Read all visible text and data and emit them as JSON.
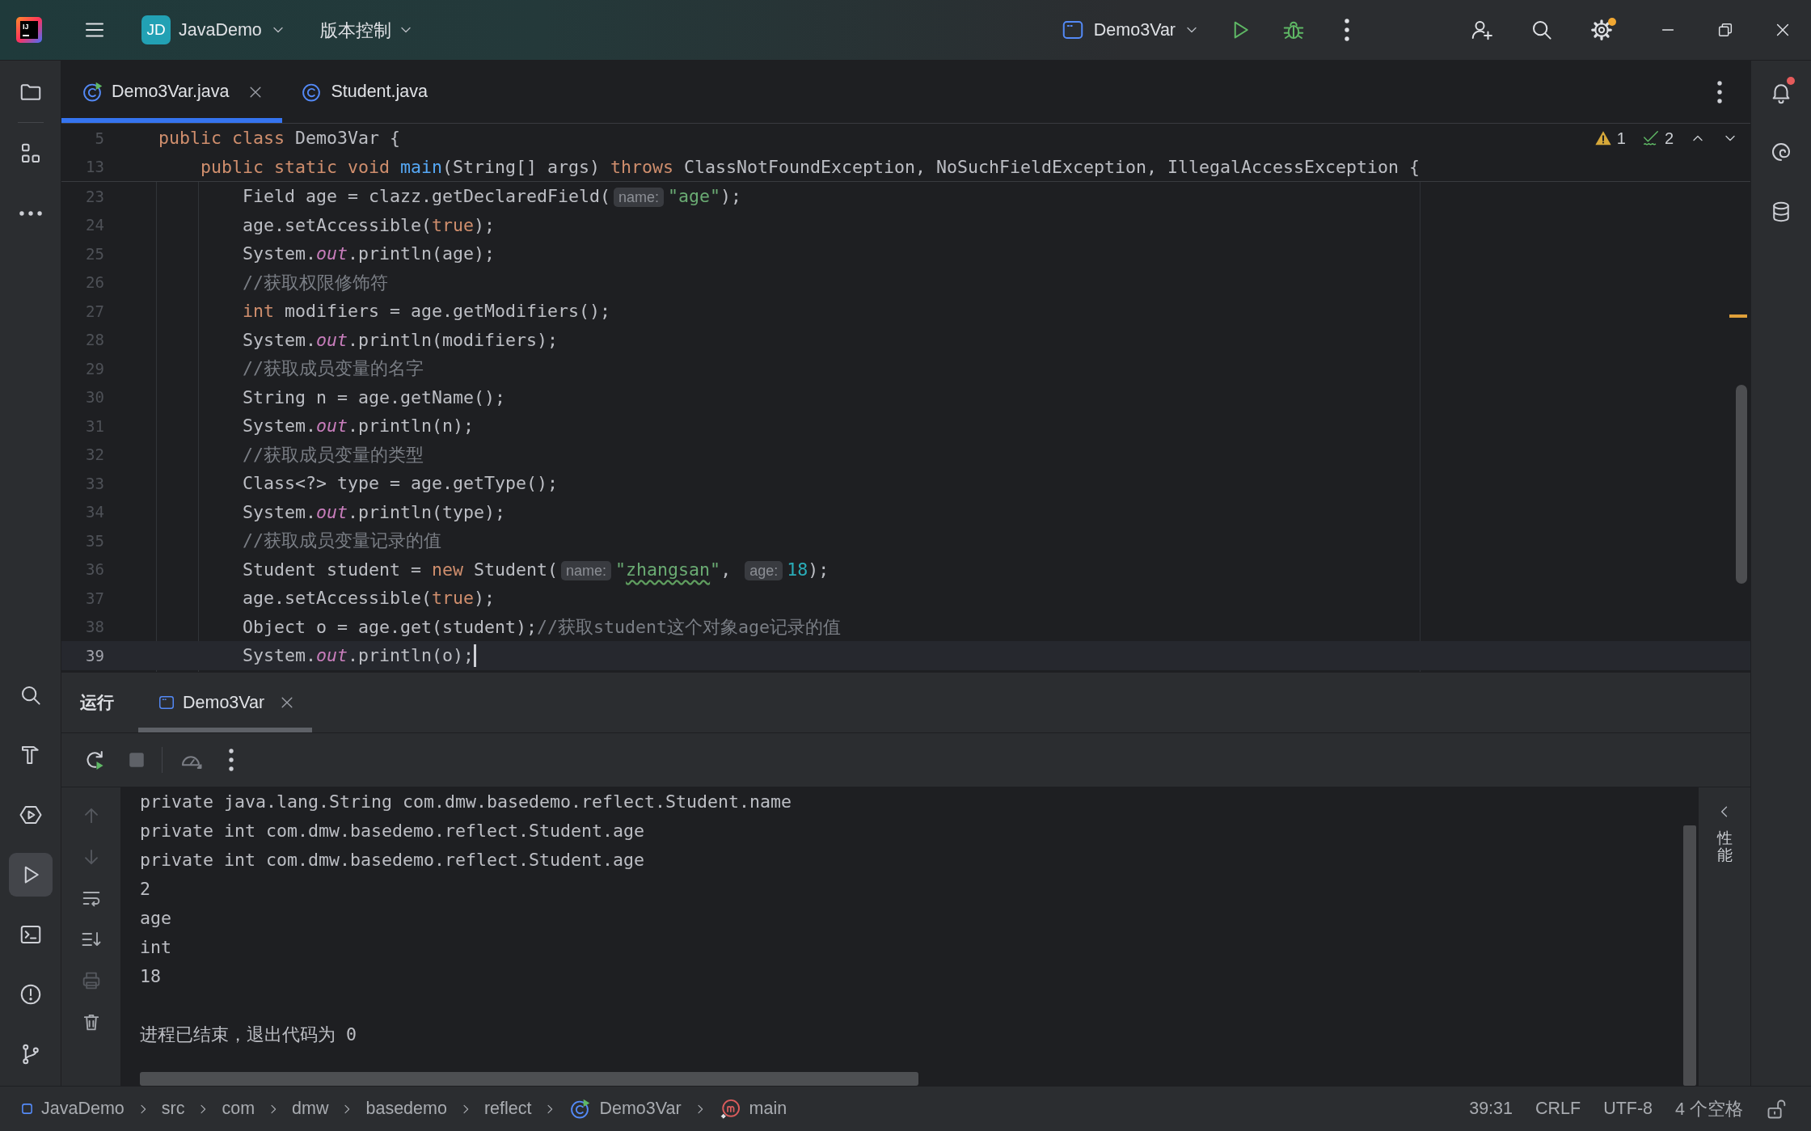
{
  "title_bar": {
    "logo": "IJ",
    "project_badge": "JD",
    "project": "JavaDemo",
    "vcs_menu": "版本控制",
    "run_config": "Demo3Var",
    "settings_update": true
  },
  "left_toolbar": {
    "top": [
      {
        "kind": "project",
        "selected": false
      },
      {
        "kind": "structure",
        "selected": false
      },
      {
        "kind": "more",
        "selected": false
      }
    ],
    "bottom": [
      {
        "kind": "search",
        "selected": false
      },
      {
        "kind": "build",
        "selected": false
      },
      {
        "kind": "services",
        "selected": false
      },
      {
        "kind": "run",
        "selected": true
      },
      {
        "kind": "terminal",
        "selected": false
      },
      {
        "kind": "problems",
        "selected": false
      },
      {
        "kind": "git",
        "selected": false
      }
    ]
  },
  "editor": {
    "tabs": [
      {
        "label": "Demo3Var.java",
        "kind": "runnable_class",
        "selected": true
      },
      {
        "label": "Student.java",
        "kind": "class",
        "selected": false
      }
    ],
    "inspections": {
      "warnings": "1",
      "weak_warnings": "2"
    },
    "sticky_lines": [
      {
        "number": "5",
        "tokens": [
          {
            "kind": "keyword",
            "text": "public class "
          },
          {
            "kind": "plain",
            "text": "Demo3Var {"
          }
        ]
      },
      {
        "number": "13",
        "tokens": [
          {
            "kind": "keyword",
            "text": "    public static void "
          },
          {
            "kind": "method",
            "text": "main"
          },
          {
            "kind": "plain",
            "text": "(String[] args) "
          },
          {
            "kind": "keyword",
            "text": "throws"
          },
          {
            "kind": "plain",
            "text": " ClassNotFoundException, NoSuchFieldException, IllegalAccessException {"
          }
        ]
      }
    ],
    "lines": [
      {
        "number": "23",
        "current": false,
        "tokens": [
          {
            "kind": "plain",
            "text": "        Field age = clazz.getDeclaredField("
          },
          {
            "kind": "hint",
            "text": "name:"
          },
          {
            "kind": "string",
            "text": "\"age\""
          },
          {
            "kind": "plain",
            "text": ");"
          }
        ]
      },
      {
        "number": "24",
        "current": false,
        "tokens": [
          {
            "kind": "plain",
            "text": "        age.setAccessible("
          },
          {
            "kind": "keyword",
            "text": "true"
          },
          {
            "kind": "plain",
            "text": ");"
          }
        ]
      },
      {
        "number": "25",
        "current": false,
        "tokens": [
          {
            "kind": "plain",
            "text": "        System."
          },
          {
            "kind": "static_field",
            "text": "out"
          },
          {
            "kind": "plain",
            "text": ".println(age);"
          }
        ]
      },
      {
        "number": "26",
        "current": false,
        "tokens": [
          {
            "kind": "comment",
            "text": "        //获取权限修饰符"
          }
        ]
      },
      {
        "number": "27",
        "current": false,
        "tokens": [
          {
            "kind": "keyword",
            "text": "        int"
          },
          {
            "kind": "plain",
            "text": " modifiers = age.getModifiers();"
          }
        ]
      },
      {
        "number": "28",
        "current": false,
        "tokens": [
          {
            "kind": "plain",
            "text": "        System."
          },
          {
            "kind": "static_field",
            "text": "out"
          },
          {
            "kind": "plain",
            "text": ".println(modifiers);"
          }
        ]
      },
      {
        "number": "29",
        "current": false,
        "tokens": [
          {
            "kind": "comment",
            "text": "        //获取成员变量的名字"
          }
        ]
      },
      {
        "number": "30",
        "current": false,
        "tokens": [
          {
            "kind": "plain",
            "text": "        String n = age.getName();"
          }
        ]
      },
      {
        "number": "31",
        "current": false,
        "tokens": [
          {
            "kind": "plain",
            "text": "        System."
          },
          {
            "kind": "static_field",
            "text": "out"
          },
          {
            "kind": "plain",
            "text": ".println(n);"
          }
        ]
      },
      {
        "number": "32",
        "current": false,
        "tokens": [
          {
            "kind": "comment",
            "text": "        //获取成员变量的类型"
          }
        ]
      },
      {
        "number": "33",
        "current": false,
        "tokens": [
          {
            "kind": "plain",
            "text": "        Class<?> type = age.getType();"
          }
        ]
      },
      {
        "number": "34",
        "current": false,
        "tokens": [
          {
            "kind": "plain",
            "text": "        System."
          },
          {
            "kind": "static_field",
            "text": "out"
          },
          {
            "kind": "plain",
            "text": ".println(type);"
          }
        ]
      },
      {
        "number": "35",
        "current": false,
        "tokens": [
          {
            "kind": "comment",
            "text": "        //获取成员变量记录的值"
          }
        ]
      },
      {
        "number": "36",
        "current": false,
        "tokens": [
          {
            "kind": "plain",
            "text": "        Student student = "
          },
          {
            "kind": "keyword",
            "text": "new"
          },
          {
            "kind": "plain",
            "text": " Student("
          },
          {
            "kind": "hint",
            "text": "name:"
          },
          {
            "kind": "string",
            "text": "\""
          },
          {
            "kind": "typo",
            "text": "zhangsan"
          },
          {
            "kind": "string",
            "text": "\""
          },
          {
            "kind": "plain",
            "text": ", "
          },
          {
            "kind": "hint",
            "text": "age:"
          },
          {
            "kind": "number",
            "text": "18"
          },
          {
            "kind": "plain",
            "text": ");"
          }
        ]
      },
      {
        "number": "37",
        "current": false,
        "tokens": [
          {
            "kind": "plain",
            "text": "        age.setAccessible("
          },
          {
            "kind": "keyword",
            "text": "true"
          },
          {
            "kind": "plain",
            "text": ");"
          }
        ]
      },
      {
        "number": "38",
        "current": false,
        "tokens": [
          {
            "kind": "plain",
            "text": "        Object o = age.get(student);"
          },
          {
            "kind": "comment",
            "text": "//获取student这个对象age记录的值"
          }
        ]
      },
      {
        "number": "39",
        "current": true,
        "tokens": [
          {
            "kind": "plain",
            "text": "        System."
          },
          {
            "kind": "static_field",
            "text": "out"
          },
          {
            "kind": "plain",
            "text": ".println(o);"
          }
        ]
      }
    ]
  },
  "run_panel": {
    "title": "运行",
    "tabs": [
      {
        "label": "Demo3Var",
        "selected": true
      }
    ],
    "toolbar": [
      {
        "kind": "rerun",
        "disabled": false
      },
      {
        "kind": "stop",
        "disabled": true
      },
      {
        "kind": "profiler",
        "disabled": true
      },
      {
        "kind": "more",
        "disabled": false
      }
    ],
    "side_actions": [
      {
        "kind": "up",
        "disabled": true
      },
      {
        "kind": "down",
        "disabled": true
      },
      {
        "kind": "soft_wrap",
        "disabled": false
      },
      {
        "kind": "scroll_to_end",
        "disabled": false
      },
      {
        "kind": "print",
        "disabled": true
      },
      {
        "kind": "clear",
        "disabled": false
      }
    ],
    "output": [
      "private java.lang.String com.dmw.basedemo.reflect.Student.name",
      "private int com.dmw.basedemo.reflect.Student.age",
      "private int com.dmw.basedemo.reflect.Student.age",
      "2",
      "age",
      "int",
      "18"
    ],
    "exit_message": "进程已结束，退出代码为 0",
    "side_panel": {
      "label": "性能"
    }
  },
  "right_toolbar": {
    "notifications_unread": true,
    "items": [
      {
        "kind": "notifications"
      },
      {
        "kind": "ai_assistant"
      },
      {
        "kind": "database"
      }
    ]
  },
  "status_bar": {
    "breadcrumbs": [
      {
        "label": "JavaDemo",
        "kind": "project"
      },
      {
        "label": "src",
        "kind": "package"
      },
      {
        "label": "com",
        "kind": "package"
      },
      {
        "label": "dmw",
        "kind": "package"
      },
      {
        "label": "basedemo",
        "kind": "package"
      },
      {
        "label": "reflect",
        "kind": "package"
      },
      {
        "label": "Demo3Var",
        "kind": "runnable_class"
      },
      {
        "label": "main",
        "kind": "method"
      }
    ],
    "position": "39:31",
    "line_separator": "CRLF",
    "encoding": "UTF-8",
    "indent": "4 个空格",
    "read_only": false
  }
}
